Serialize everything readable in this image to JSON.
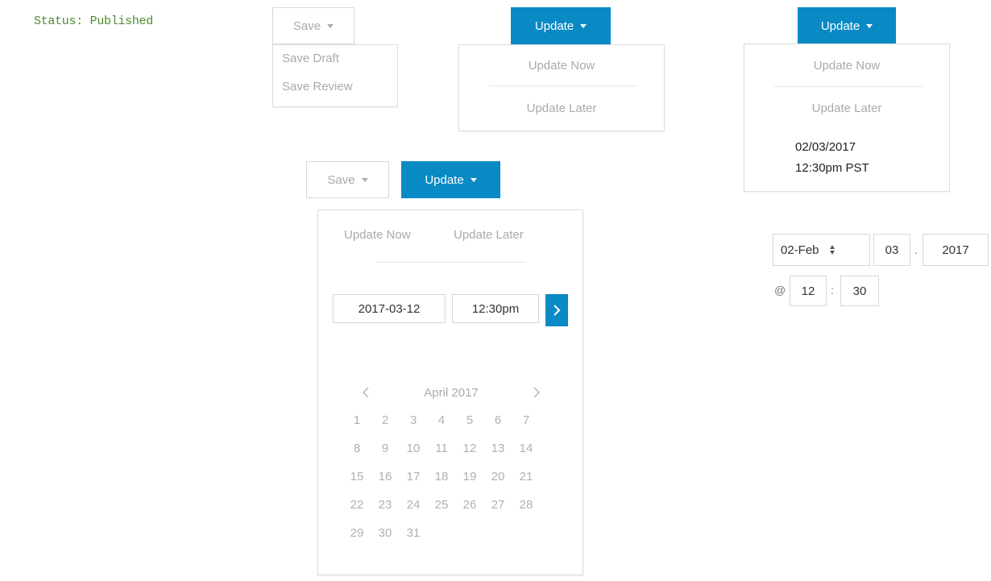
{
  "status": "Status: Published",
  "save": {
    "label": "Save",
    "menu": [
      "Save Draft",
      "Save Review"
    ]
  },
  "update": {
    "label": "Update",
    "now": "Update Now",
    "later": "Update Later"
  },
  "scheduled": {
    "date": "02/03/2017",
    "time": "12:30pm PST"
  },
  "picker": {
    "date_value": "2017-03-12",
    "time_value": "12:30pm",
    "go_icon": "chevron-right-icon",
    "month_label": "April 2017",
    "prev_icon": "chevron-left-icon",
    "next_icon": "chevron-right-icon",
    "days": [
      "1",
      "2",
      "3",
      "4",
      "5",
      "6",
      "7",
      "8",
      "9",
      "10",
      "11",
      "12",
      "13",
      "14",
      "15",
      "16",
      "17",
      "18",
      "19",
      "20",
      "21",
      "22",
      "23",
      "24",
      "25",
      "26",
      "27",
      "28",
      "29",
      "30",
      "31"
    ]
  },
  "alt_picker": {
    "month_day": "02-Feb",
    "day": "03",
    "year": "2017",
    "dot": ".",
    "at": "@",
    "hour": "12",
    "colon": ":",
    "minute": "30"
  },
  "colors": {
    "accent": "#0a8ac4",
    "status": "#4f8a2e"
  }
}
